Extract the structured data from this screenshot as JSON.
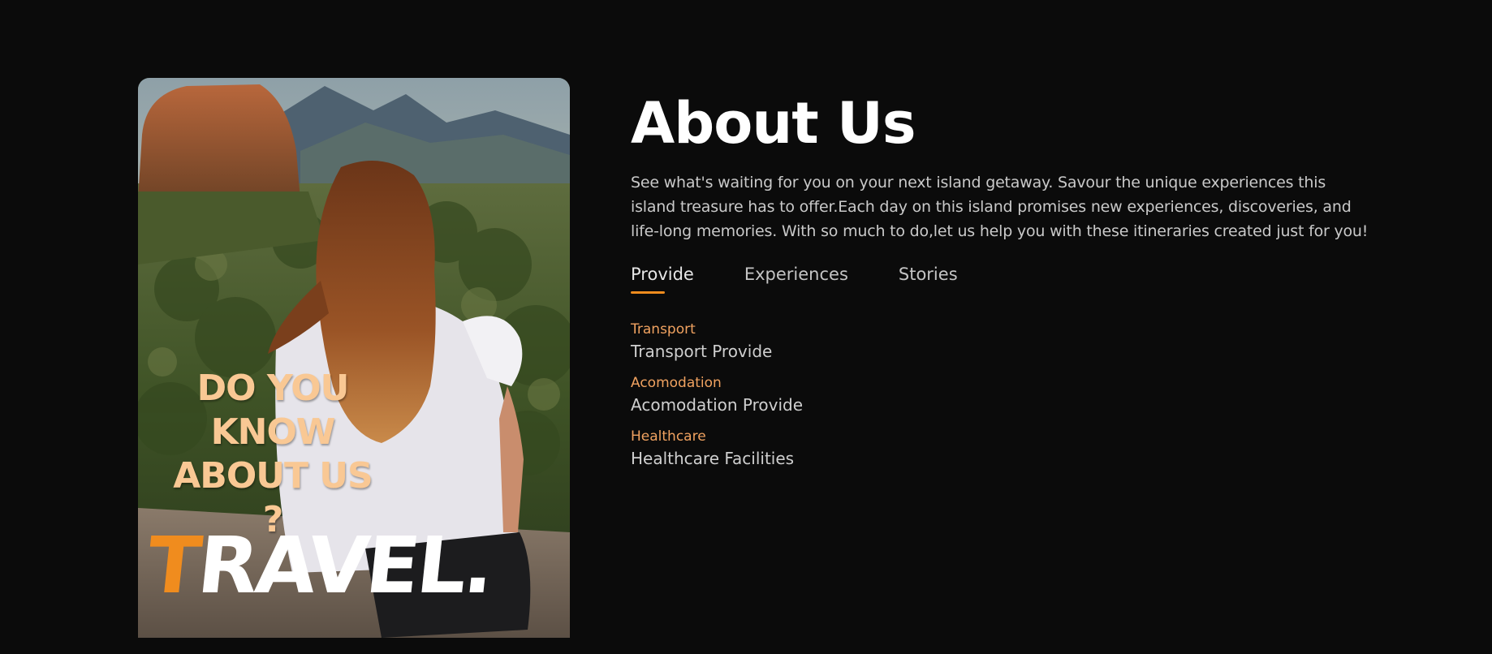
{
  "poster": {
    "question_lines": [
      "DO YOU",
      "KNOW",
      "ABOUT US ?"
    ],
    "brand_first_letter": "T",
    "brand_rest": "RAVEL.",
    "accent_color": "#f08c1e",
    "question_color": "#f9c894"
  },
  "about": {
    "title": "About Us",
    "intro": "See what's waiting for you on your next island getaway. Savour the unique experiences this island treasure has to offer.Each day on this island promises new experiences, discoveries, and life-long memories. With so much to do,let us help you with these itineraries created just for you!"
  },
  "tabs": [
    {
      "label": "Provide",
      "active": true
    },
    {
      "label": "Experiences",
      "active": false
    },
    {
      "label": "Stories",
      "active": false
    }
  ],
  "provide": [
    {
      "name": "Transport",
      "description": "Transport Provide"
    },
    {
      "name": "Acomodation",
      "description": "Acomodation Provide"
    },
    {
      "name": "Healthcare",
      "description": "Healthcare Facilities"
    }
  ],
  "colors": {
    "background": "#0b0b0b",
    "accent": "#f08c1e",
    "item_title": "#f0a260"
  }
}
